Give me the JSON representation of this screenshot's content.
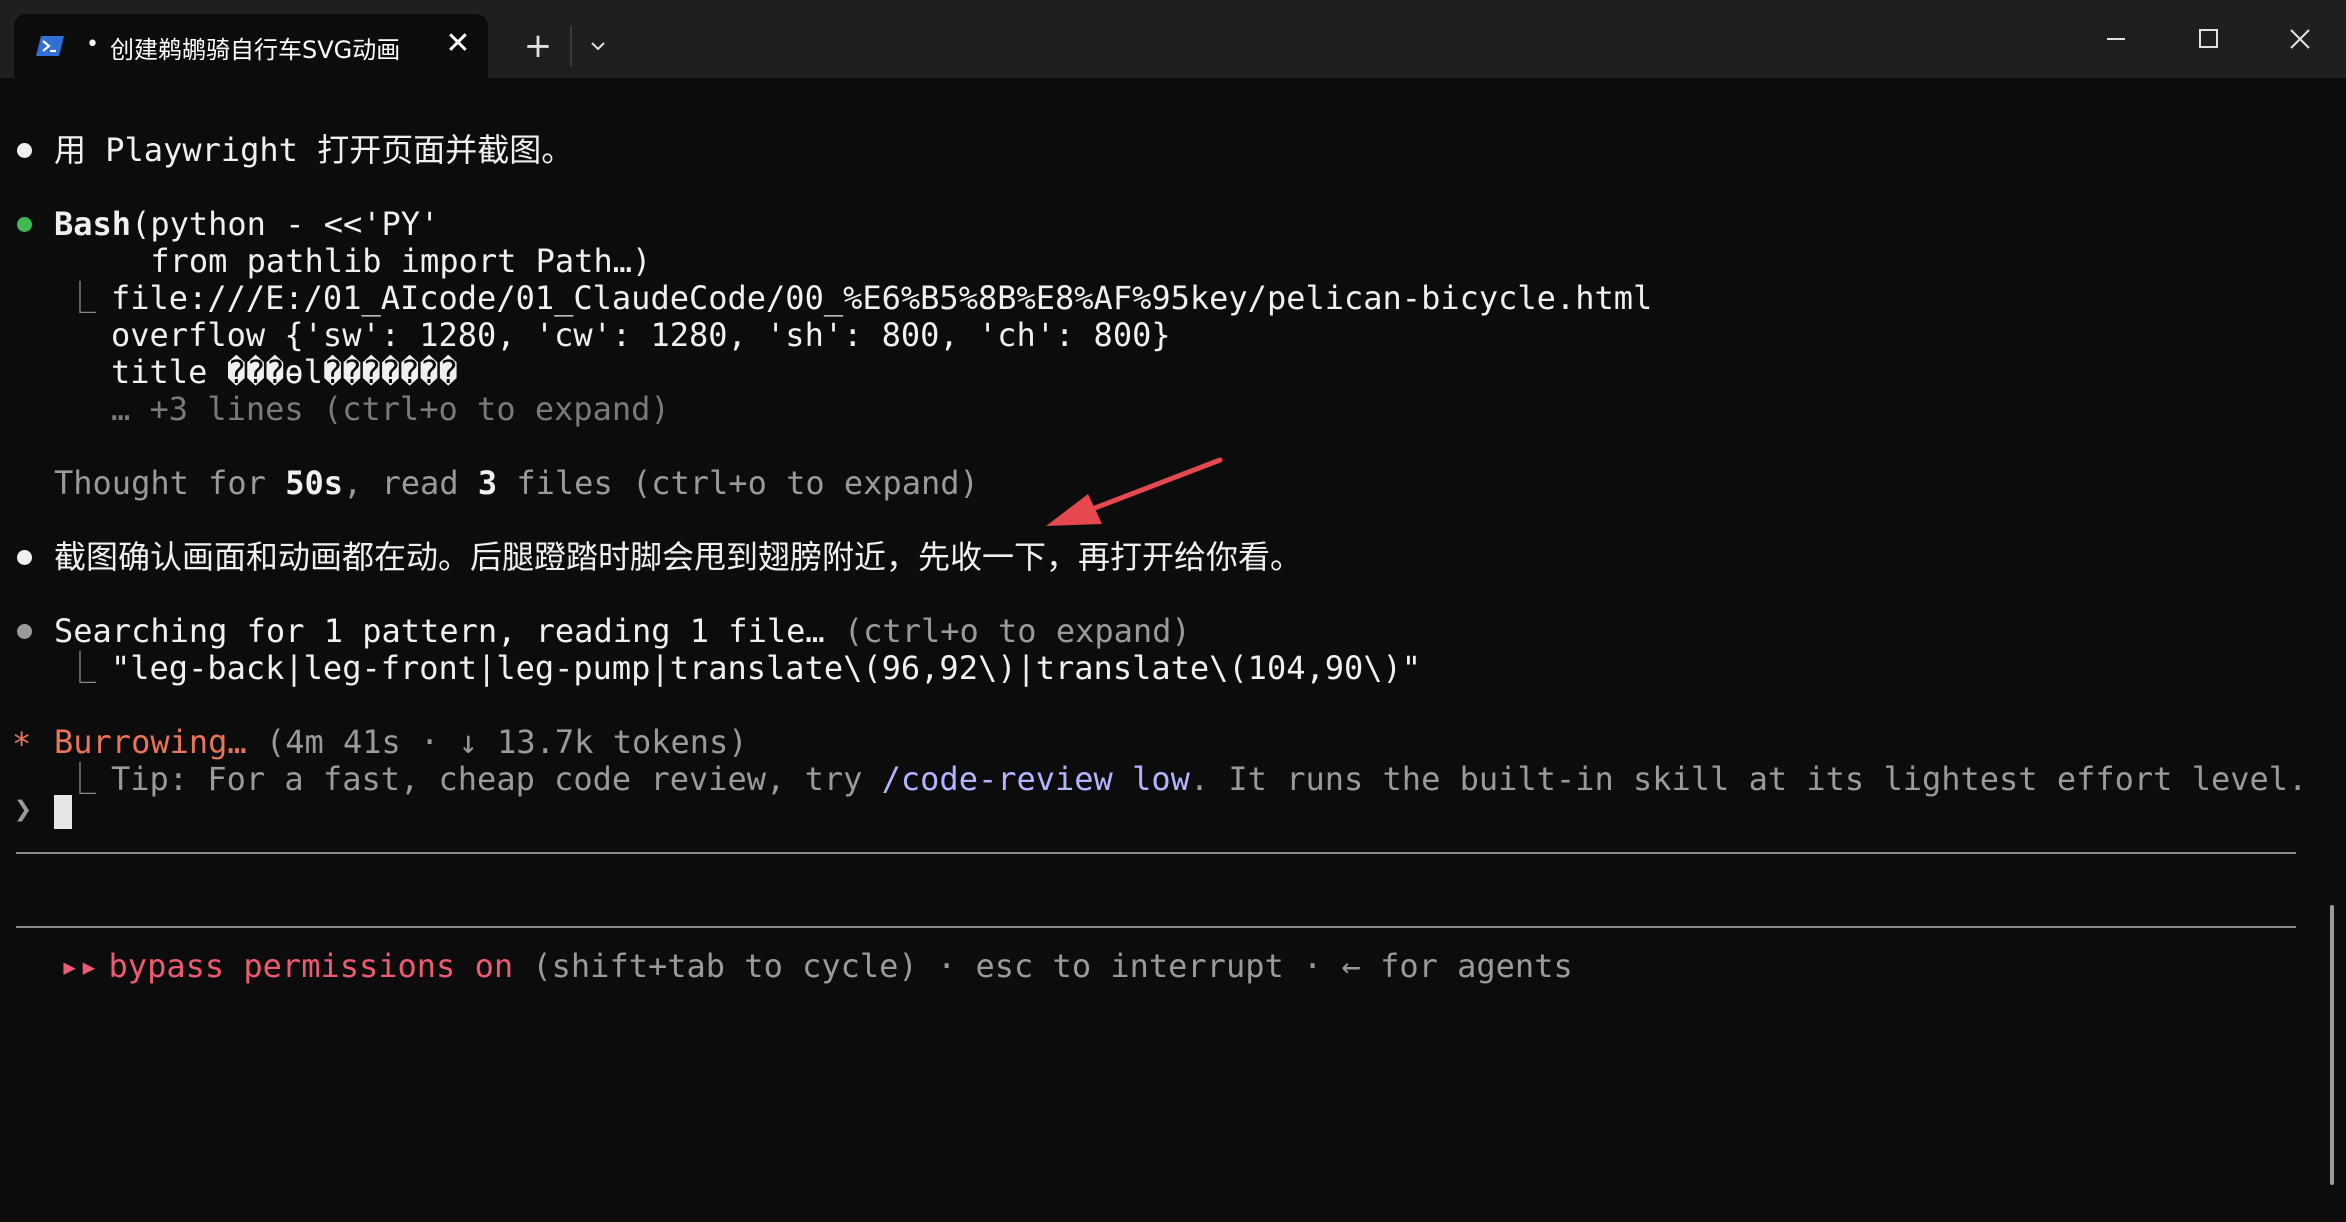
{
  "window": {
    "tab_title": "创建鹈鹕骑自行车SVG动画",
    "tab_dot": "•",
    "close_tab_icon": "close-icon",
    "new_tab_icon": "plus-icon",
    "dropdown_icon": "chevron-down-icon",
    "controls": [
      "minimize-icon",
      "maximize-icon",
      "close-icon"
    ]
  },
  "terminal": {
    "msg1": "用 Playwright 打开页面并截图。",
    "bash": {
      "label": "Bash",
      "cmd": "(python - <<'PY'",
      "cmd2": "     from pathlib import Path…)",
      "out1": "file:///E:/01_AIcode/01_ClaudeCode/00_%E6%B5%8B%E8%AF%95key/pelican-bicycle.html",
      "out2": "overflow {'sw': 1280, 'cw': 1280, 'sh': 800, 'ch': 800}",
      "out3": "title ���ɵl�������",
      "out4": "… +3 lines (ctrl+o to expand)"
    },
    "thought": {
      "prefix": "Thought for ",
      "time": "50s",
      "mid": ", read ",
      "count": "3",
      "suffix": " files (ctrl+o to expand)"
    },
    "msg2": "截图确认画面和动画都在动。后腿蹬踏时脚会甩到翅膀附近，先收一下，再打开给你看。",
    "search": {
      "label": "Searching for 1 pattern, reading 1 file…",
      "hint": " (ctrl+o to expand)",
      "pattern": "\"leg-back|leg-front|leg-pump|translate\\(96,92\\)|translate\\(104,90\\)\""
    },
    "status": {
      "star": "*",
      "label": "Burrowing…",
      "detail": " (4m 41s · ↓ 13.7k tokens)"
    },
    "tip": {
      "prefix": "Tip: For a fast, cheap code review, try ",
      "command": "/code-review low",
      "suffix": ". It runs the built-in skill at its lightest effort level."
    },
    "prompt_symbol": "❯",
    "footer": {
      "icon": "▸▸",
      "mode": "bypass permissions on",
      "rest": " (shift+tab to cycle) · esc to interrupt · ← for agents"
    }
  },
  "colors": {
    "background": "#0c0c0c",
    "titlebar": "#1f1f1f",
    "accent_green": "#3fb950",
    "accent_orange": "#e8745a",
    "accent_pink": "#ee5a72",
    "accent_lilac": "#b3b4ff",
    "annotation_arrow": "#e5484d"
  }
}
